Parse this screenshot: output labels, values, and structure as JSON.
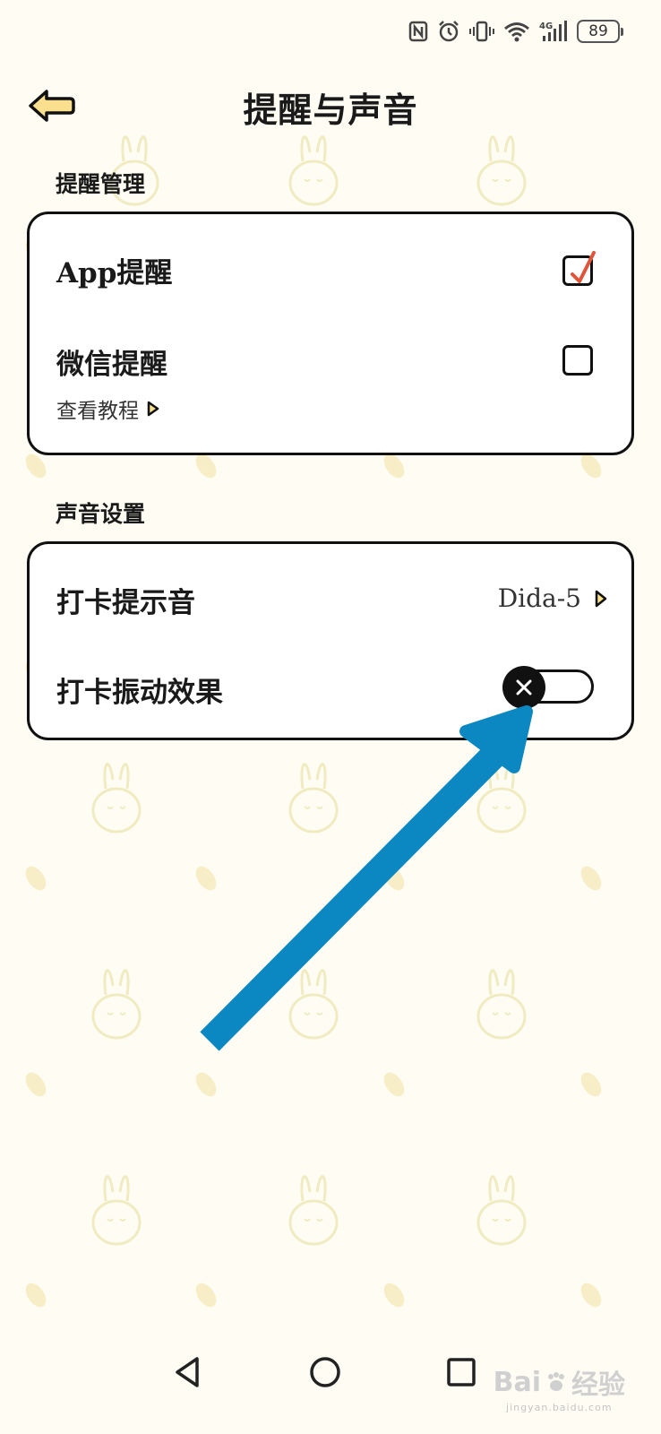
{
  "status_bar": {
    "icons": [
      "nfc-icon",
      "alarm-icon",
      "vibrate-icon",
      "wifi-icon",
      "signal-4g-icon",
      "battery-icon"
    ],
    "network_label": "4G",
    "battery_level": "89"
  },
  "header": {
    "back_icon": "arrow-left-icon",
    "title": "提醒与声音"
  },
  "notifications": {
    "section_title": "提醒管理",
    "app_reminder": {
      "label": "App提醒",
      "checked": true
    },
    "wechat_reminder": {
      "label": "微信提醒",
      "checked": false
    },
    "tutorial_link": "查看教程"
  },
  "sound": {
    "section_title": "声音设置",
    "checkin_sound": {
      "label": "打卡提示音",
      "value": "Dida-5"
    },
    "checkin_vibration": {
      "label": "打卡振动效果",
      "enabled": false
    }
  },
  "nav_bar": {
    "buttons": [
      "back-triangle-icon",
      "home-circle-icon",
      "recents-square-icon"
    ]
  },
  "watermark": {
    "brand": "Bai",
    "brand_suffix": "经验",
    "url": "jingyan.baidu.com"
  },
  "colors": {
    "background": "#fffdf3",
    "card_border": "#111111",
    "accent_arrow": "#0b88c2",
    "check_mark": "#e0543a",
    "back_arrow_fill": "#f9df8e"
  }
}
